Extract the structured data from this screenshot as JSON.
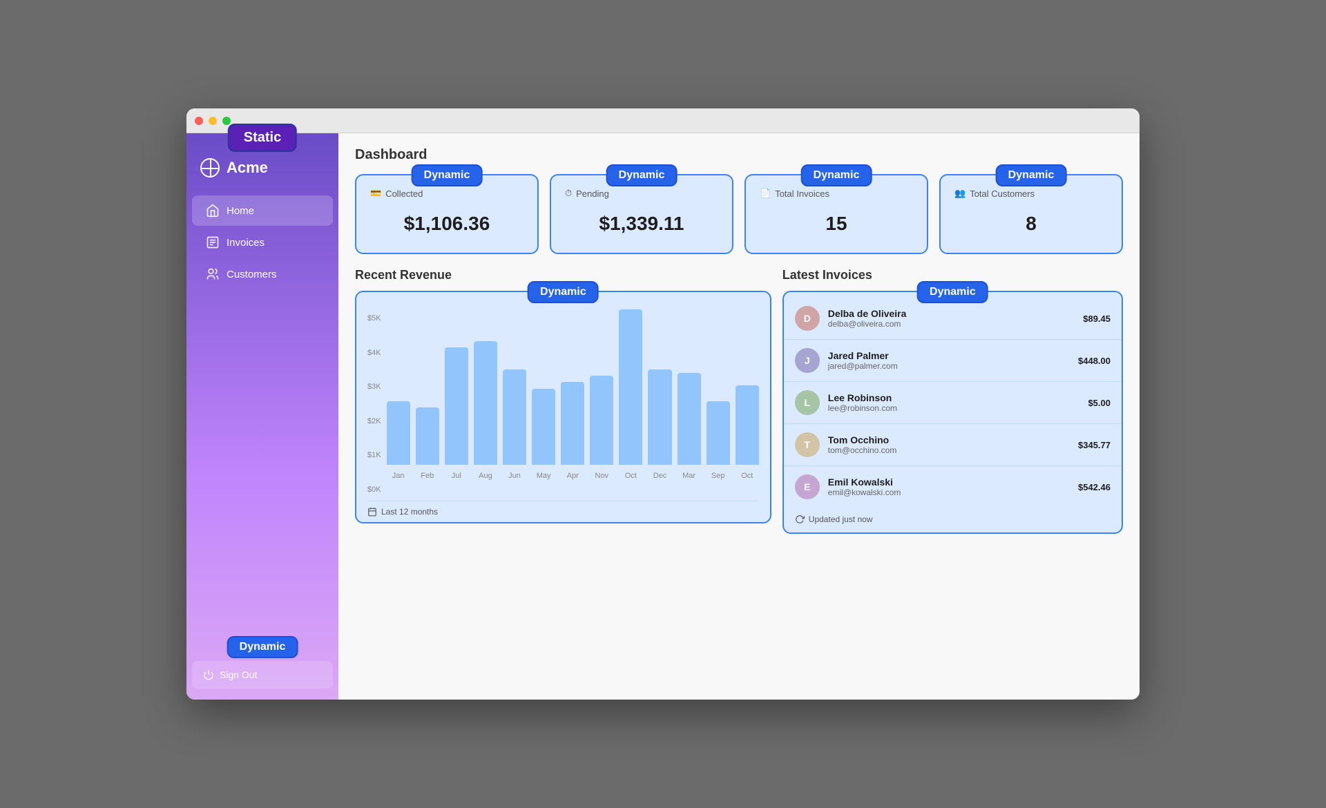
{
  "window": {
    "title": "Acme Dashboard"
  },
  "sidebar": {
    "static_badge": "Static",
    "logo": "Acme",
    "nav_items": [
      {
        "id": "home",
        "label": "Home",
        "active": true
      },
      {
        "id": "invoices",
        "label": "Invoices",
        "active": false
      },
      {
        "id": "customers",
        "label": "Customers",
        "active": false
      }
    ],
    "sign_out_label": "Sign Out",
    "sign_out_dynamic_badge": "Dynamic"
  },
  "main": {
    "page_title": "Dashboard",
    "stats": [
      {
        "id": "collected",
        "dynamic_badge": "Dynamic",
        "icon": "💳",
        "label": "Collected",
        "value": "$1,106.36"
      },
      {
        "id": "pending",
        "dynamic_badge": "Dynamic",
        "icon": "⏱",
        "label": "Pending",
        "value": "$1,339.11"
      },
      {
        "id": "total-invoices",
        "dynamic_badge": "Dynamic",
        "icon": "📄",
        "label": "Total Invoices",
        "value": "15"
      },
      {
        "id": "total-customers",
        "dynamic_badge": "Dynamic",
        "icon": "👥",
        "label": "Total Customers",
        "value": "8"
      }
    ],
    "chart": {
      "section_title": "Recent Revenue",
      "dynamic_badge": "Dynamic",
      "bars": [
        {
          "month": "Jan",
          "value": 2000,
          "height_pct": 40
        },
        {
          "month": "Feb",
          "value": 1800,
          "height_pct": 36
        },
        {
          "month": "Jul",
          "value": 3700,
          "height_pct": 74
        },
        {
          "month": "Aug",
          "value": 3900,
          "height_pct": 78
        },
        {
          "month": "Jun",
          "value": 3000,
          "height_pct": 60
        },
        {
          "month": "May",
          "value": 2400,
          "height_pct": 48
        },
        {
          "month": "Apr",
          "value": 2600,
          "height_pct": 52
        },
        {
          "month": "Nov",
          "value": 2800,
          "height_pct": 56
        },
        {
          "month": "Oct",
          "value": 4900,
          "height_pct": 98
        },
        {
          "month": "Dec",
          "value": 3000,
          "height_pct": 60
        },
        {
          "month": "Mar",
          "value": 2900,
          "height_pct": 58
        },
        {
          "month": "Sep",
          "value": 2000,
          "height_pct": 40
        },
        {
          "month": "Oct2",
          "value": 2500,
          "height_pct": 50
        }
      ],
      "y_labels": [
        "$5K",
        "$4K",
        "$3K",
        "$2K",
        "$1K",
        "$0K"
      ],
      "footer": "Last 12 months"
    },
    "invoices": {
      "section_title": "Latest Invoices",
      "dynamic_badge": "Dynamic",
      "rows": [
        {
          "name": "Delba de Oliveira",
          "email": "delba@oliveira.com",
          "amount": "$89.45",
          "initials": "D",
          "avatar_class": "avatar-1"
        },
        {
          "name": "Jared Palmer",
          "email": "jared@palmer.com",
          "amount": "$448.00",
          "initials": "J",
          "avatar_class": "avatar-2"
        },
        {
          "name": "Lee Robinson",
          "email": "lee@robinson.com",
          "amount": "$5.00",
          "initials": "L",
          "avatar_class": "avatar-3"
        },
        {
          "name": "Tom Occhino",
          "email": "tom@occhino.com",
          "amount": "$345.77",
          "initials": "T",
          "avatar_class": "avatar-4"
        },
        {
          "name": "Emil Kowalski",
          "email": "emil@kowalski.com",
          "amount": "$542.46",
          "initials": "E",
          "avatar_class": "avatar-5"
        }
      ],
      "footer": "Updated just now"
    }
  }
}
